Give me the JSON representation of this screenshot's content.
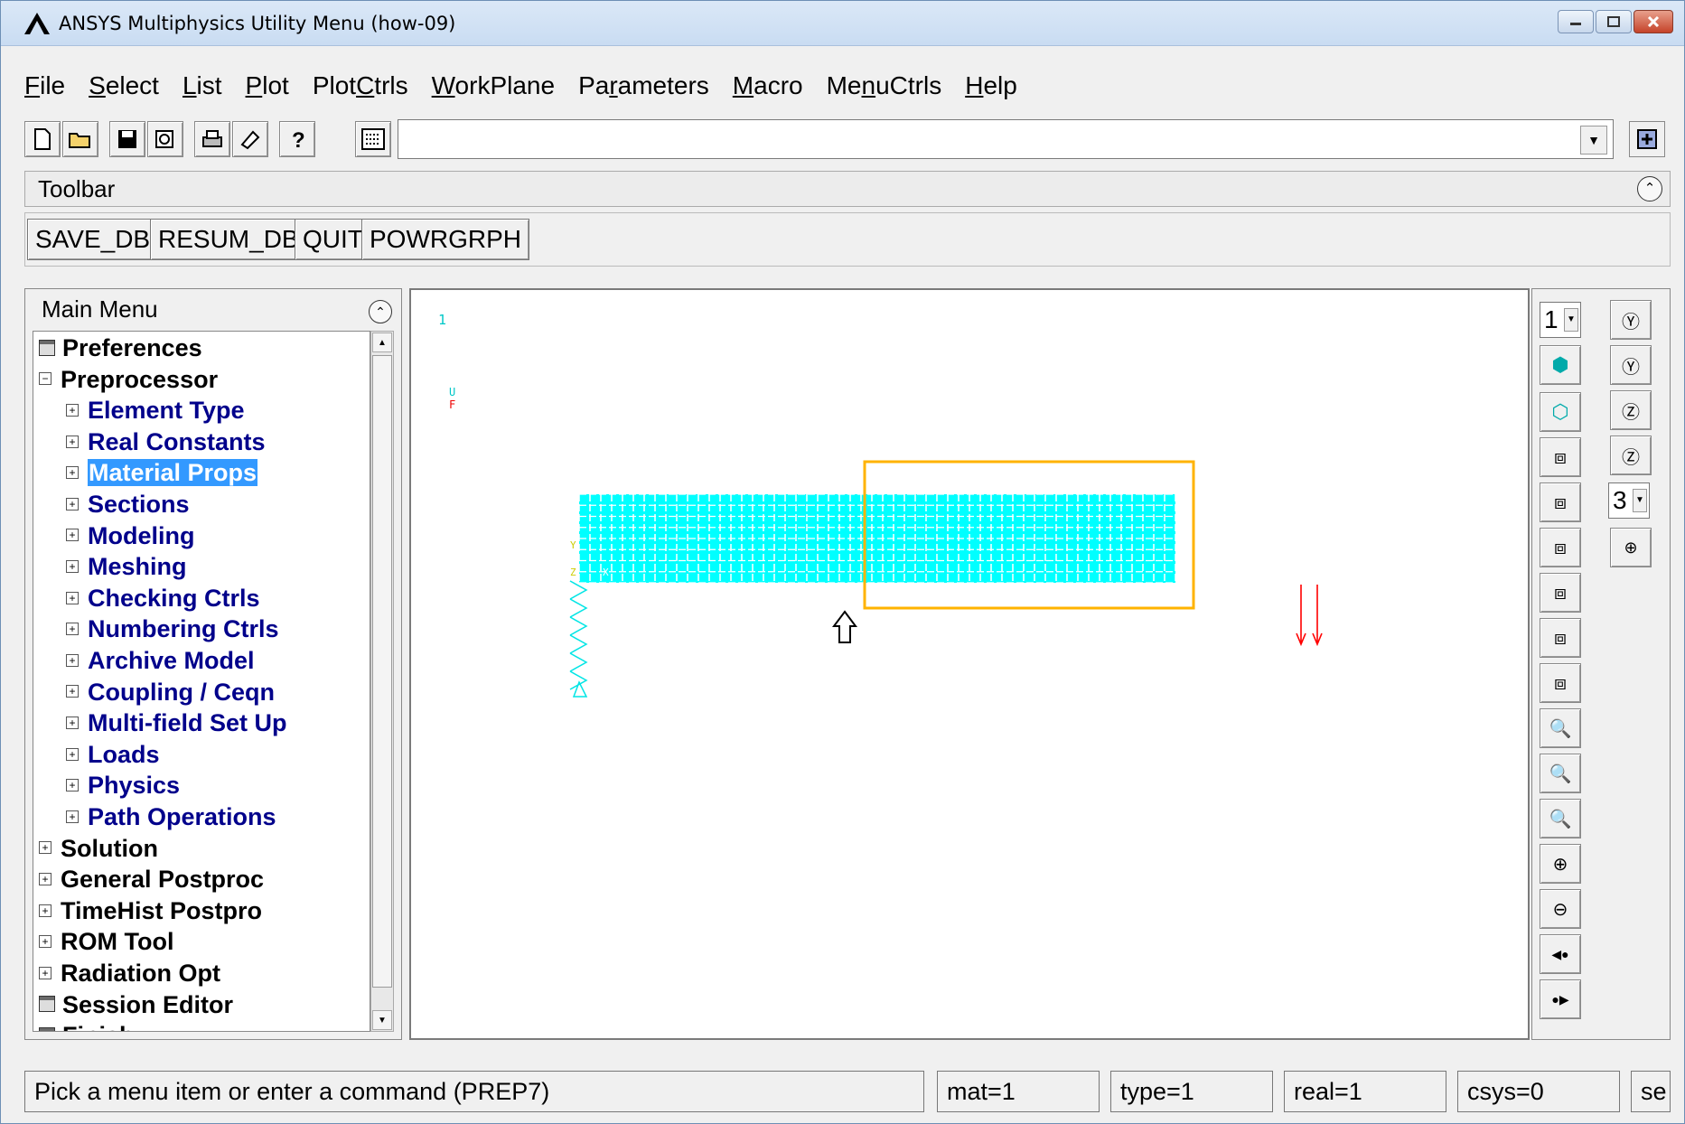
{
  "window": {
    "title": "ANSYS Multiphysics Utility Menu (how-09)"
  },
  "menubar": {
    "items": [
      {
        "pre": "",
        "ul": "F",
        "post": "ile"
      },
      {
        "pre": "",
        "ul": "S",
        "post": "elect"
      },
      {
        "pre": "",
        "ul": "L",
        "post": "ist"
      },
      {
        "pre": "",
        "ul": "P",
        "post": "lot"
      },
      {
        "pre": "Plot",
        "ul": "C",
        "post": "trls"
      },
      {
        "pre": "",
        "ul": "W",
        "post": "orkPlane"
      },
      {
        "pre": "Pa",
        "ul": "r",
        "post": "ameters"
      },
      {
        "pre": "",
        "ul": "M",
        "post": "acro"
      },
      {
        "pre": "Me",
        "ul": "n",
        "post": "uCtrls"
      },
      {
        "pre": "",
        "ul": "H",
        "post": "elp"
      }
    ]
  },
  "command": {
    "value": ""
  },
  "toolbar": {
    "title": "Toolbar",
    "buttons": [
      "SAVE_DB",
      "RESUM_DB",
      "QUIT",
      "POWRGRPH"
    ]
  },
  "main_menu": {
    "title": "Main Menu",
    "items": [
      {
        "label": "Preferences",
        "marker": "doc",
        "indent": 0,
        "color": "black"
      },
      {
        "label": "Preprocessor",
        "marker": "minus",
        "indent": 0,
        "color": "black"
      },
      {
        "label": "Element Type",
        "marker": "plus",
        "indent": 1,
        "color": "blue"
      },
      {
        "label": "Real Constants",
        "marker": "plus",
        "indent": 1,
        "color": "blue"
      },
      {
        "label": "Material Props",
        "marker": "plus",
        "indent": 1,
        "color": "selected"
      },
      {
        "label": "Sections",
        "marker": "plus",
        "indent": 1,
        "color": "blue"
      },
      {
        "label": "Modeling",
        "marker": "plus",
        "indent": 1,
        "color": "blue"
      },
      {
        "label": "Meshing",
        "marker": "plus",
        "indent": 1,
        "color": "blue"
      },
      {
        "label": "Checking Ctrls",
        "marker": "plus",
        "indent": 1,
        "color": "blue"
      },
      {
        "label": "Numbering Ctrls",
        "marker": "plus",
        "indent": 1,
        "color": "blue"
      },
      {
        "label": "Archive Model",
        "marker": "plus",
        "indent": 1,
        "color": "blue"
      },
      {
        "label": "Coupling / Ceqn",
        "marker": "plus",
        "indent": 1,
        "color": "blue"
      },
      {
        "label": "Multi-field Set Up",
        "marker": "plus",
        "indent": 1,
        "color": "blue"
      },
      {
        "label": "Loads",
        "marker": "plus",
        "indent": 1,
        "color": "blue"
      },
      {
        "label": "Physics",
        "marker": "plus",
        "indent": 1,
        "color": "blue"
      },
      {
        "label": "Path Operations",
        "marker": "plus",
        "indent": 1,
        "color": "blue"
      },
      {
        "label": "Solution",
        "marker": "plus",
        "indent": 0,
        "color": "black"
      },
      {
        "label": "General Postproc",
        "marker": "plus",
        "indent": 0,
        "color": "black"
      },
      {
        "label": "TimeHist Postpro",
        "marker": "plus",
        "indent": 0,
        "color": "black"
      },
      {
        "label": "ROM Tool",
        "marker": "plus",
        "indent": 0,
        "color": "black"
      },
      {
        "label": "Radiation Opt",
        "marker": "plus",
        "indent": 0,
        "color": "black"
      },
      {
        "label": "Session Editor",
        "marker": "doc",
        "indent": 0,
        "color": "black"
      },
      {
        "label": "Finish",
        "marker": "doc",
        "indent": 0,
        "color": "black"
      }
    ]
  },
  "graphics": {
    "window_number": "1",
    "legend_u": "U",
    "legend_f": "F",
    "axis_y": "Y",
    "axis_z": "Z",
    "axis_x": "X",
    "mesh_color": "#00ffff",
    "highlight_color": "#ffb300",
    "force_color": "#ff0000"
  },
  "viewbar": {
    "window_select": "1",
    "rotate_select": "3"
  },
  "statusbar": {
    "prompt": "Pick a menu item or enter a command (PREP7)",
    "mat": "mat=1",
    "type": "type=1",
    "real": "real=1",
    "csys": "csys=0",
    "secn": "se"
  }
}
